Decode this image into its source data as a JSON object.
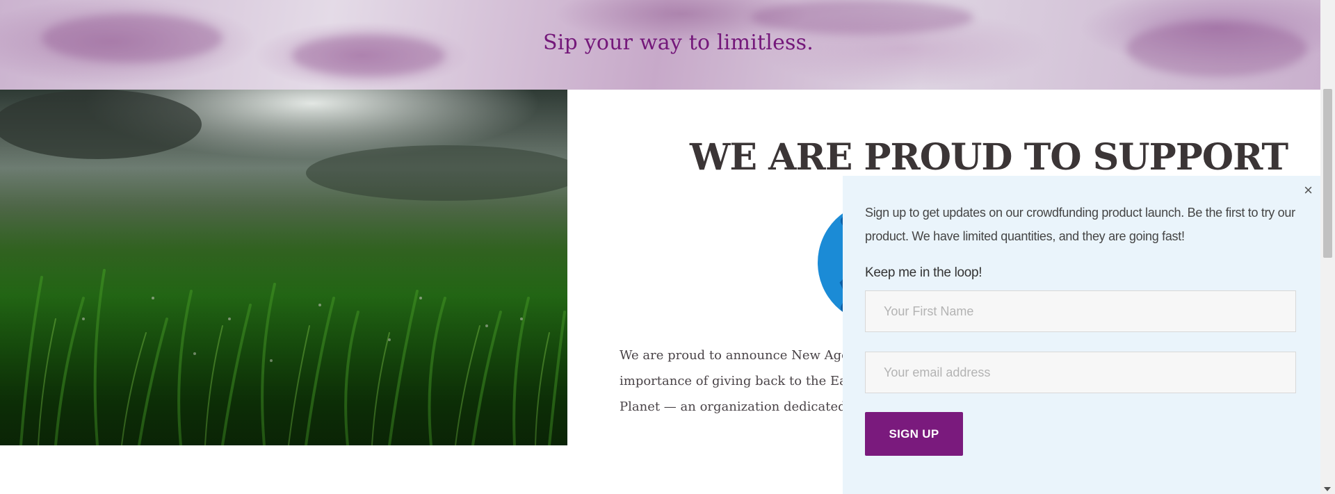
{
  "hero": {
    "tagline": "Sip your way to limitless."
  },
  "section": {
    "heading": "WE ARE PROUD TO SUPPORT",
    "body_lines": [
      "We are proud to announce New Age D",
      "importance of giving back to the Eart",
      "Planet — an organization dedicated t"
    ]
  },
  "popup": {
    "close_label": "×",
    "description": "Sign up to get updates on our crowdfunding product launch. Be the first to try our product. We have limited quantities, and they are going fast!",
    "label": "Keep me in the loop!",
    "first_name_placeholder": "Your First Name",
    "email_placeholder": "Your email address",
    "submit_label": "SIGN UP"
  },
  "colors": {
    "brand_purple": "#7a1a7d",
    "popup_bg": "#eaf4fb",
    "heading_text": "#3b3536"
  },
  "icons": {
    "close": "close-icon",
    "scroll_down": "chevron-down-icon"
  }
}
